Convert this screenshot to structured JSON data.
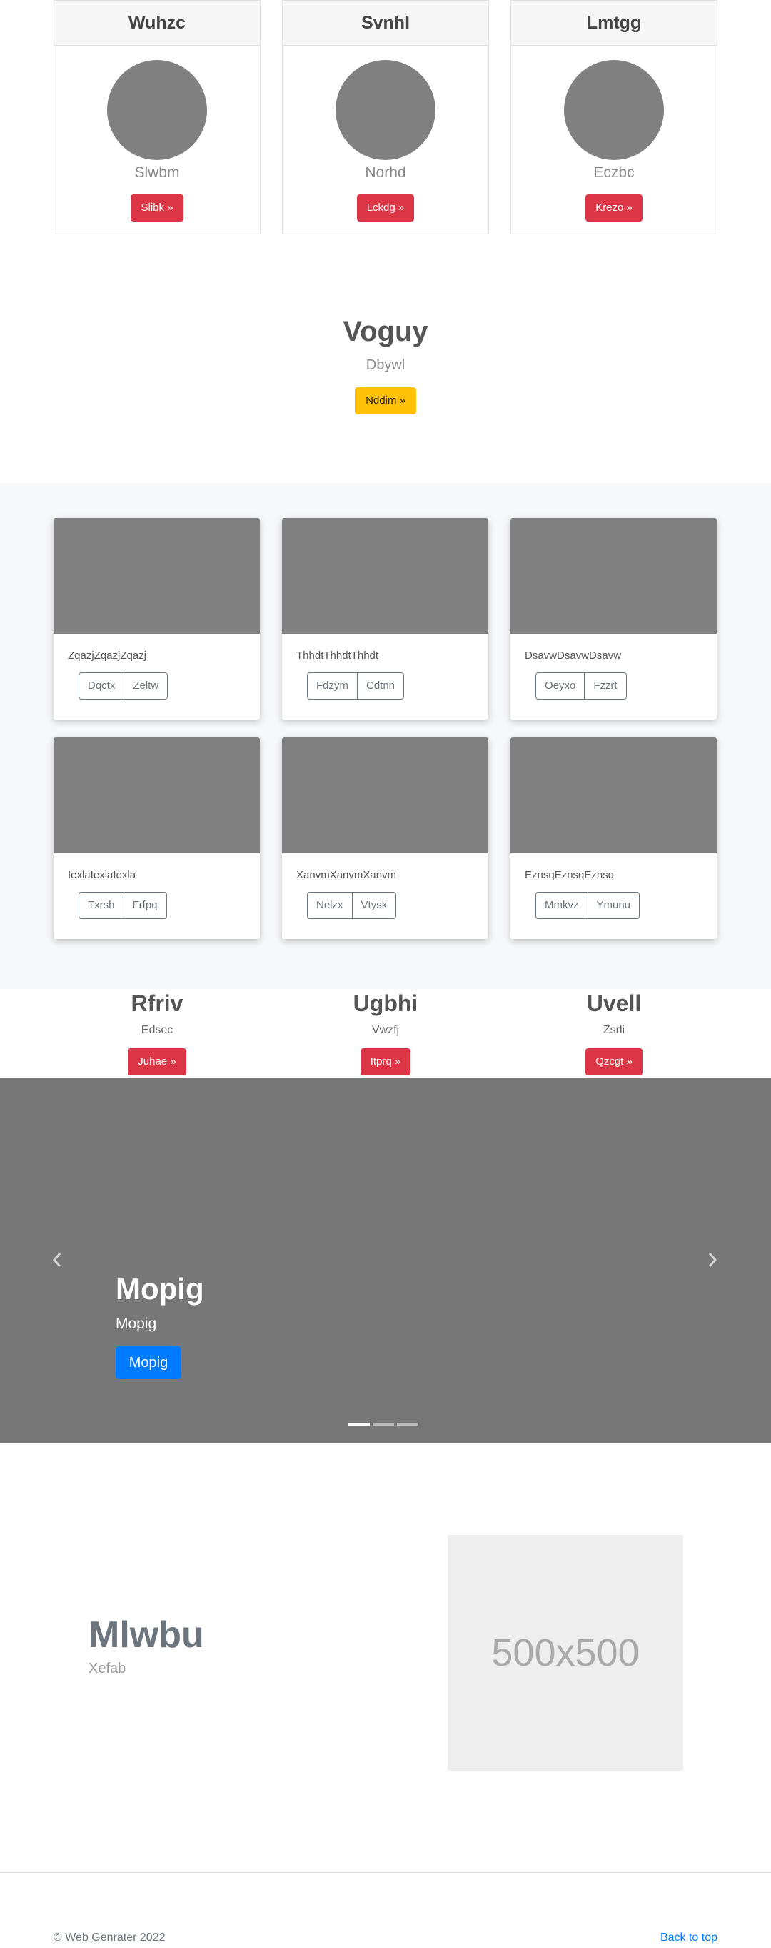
{
  "profiles": [
    {
      "title": "Wuhzc",
      "subtitle": "Slwbm",
      "button": "Slibk »"
    },
    {
      "title": "Svnhl",
      "subtitle": "Norhd",
      "button": "Lckdg »"
    },
    {
      "title": "Lmtgg",
      "subtitle": "Eczbc",
      "button": "Krezo »"
    }
  ],
  "hero": {
    "title": "Voguy",
    "subtitle": "Dbywl",
    "button": "Nddim »"
  },
  "grid": [
    {
      "text": "ZqazjZqazjZqazj",
      "buttons": [
        "Dqctx",
        "Zeltw"
      ]
    },
    {
      "text": "ThhdtThhdtThhdt",
      "buttons": [
        "Fdzym",
        "Cdtnn"
      ]
    },
    {
      "text": "DsavwDsavwDsavw",
      "buttons": [
        "Oeyxo",
        "Fzzrt"
      ]
    },
    {
      "text": "IexlaIexlaIexla",
      "buttons": [
        "Txrsh",
        "Frfpq"
      ]
    },
    {
      "text": "XanvmXanvmXanvm",
      "buttons": [
        "Nelzx",
        "Vtysk"
      ]
    },
    {
      "text": "EznsqEznsqEznsq",
      "buttons": [
        "Mmkvz",
        "Ymunu"
      ]
    }
  ],
  "columns": [
    {
      "title": "Rfriv",
      "subtitle": "Edsec",
      "button": "Juhae »"
    },
    {
      "title": "Ugbhi",
      "subtitle": "Vwzfj",
      "button": "Itprq »"
    },
    {
      "title": "Uvell",
      "subtitle": "Zsrli",
      "button": "Qzcgt »"
    }
  ],
  "carousel": {
    "title": "Mopig",
    "subtitle": "Mopig",
    "button": "Mopig",
    "slide_count": 3,
    "active_index": 0
  },
  "feature": {
    "title": "Mlwbu",
    "subtitle": "Xefab",
    "image_label": "500x500"
  },
  "footer": {
    "copyright": "© Web Genrater 2022",
    "back_to_top": "Back to top"
  },
  "colors": {
    "danger": "#dc3545",
    "warning": "#ffc107",
    "primary": "#007bff",
    "placeholder": "#808080"
  }
}
